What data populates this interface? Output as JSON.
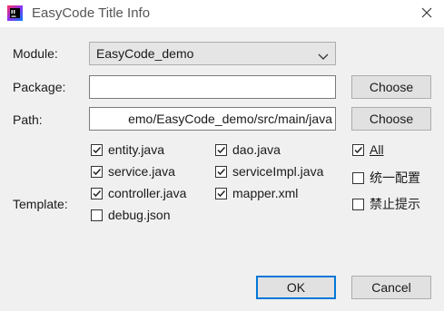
{
  "window": {
    "title": "EasyCode Title Info",
    "app_icon": "intellij-logo-icon",
    "close_icon": "close-icon"
  },
  "module": {
    "label": "Module:",
    "selected": "EasyCode_demo"
  },
  "package": {
    "label": "Package:",
    "value": "",
    "button": "Choose"
  },
  "path": {
    "label": "Path:",
    "value": "emo/EasyCode_demo/src/main/java",
    "button": "Choose"
  },
  "template": {
    "label": "Template:",
    "items": [
      {
        "label": "entity.java",
        "checked": true
      },
      {
        "label": "dao.java",
        "checked": true
      },
      {
        "label": "service.java",
        "checked": true
      },
      {
        "label": "serviceImpl.java",
        "checked": true
      },
      {
        "label": "controller.java",
        "checked": true
      },
      {
        "label": "mapper.xml",
        "checked": true
      },
      {
        "label": "debug.json",
        "checked": false
      }
    ]
  },
  "options": {
    "all": {
      "label": "All",
      "checked": true
    },
    "unify_config": {
      "label": "统一配置",
      "checked": false
    },
    "no_prompt": {
      "label": "禁止提示",
      "checked": false
    }
  },
  "buttons": {
    "ok": "OK",
    "cancel": "Cancel"
  },
  "colors": {
    "focus_accent": "#0078d7",
    "window_bg": "#f0f0f0",
    "titlebar_bg": "#ffffff"
  }
}
